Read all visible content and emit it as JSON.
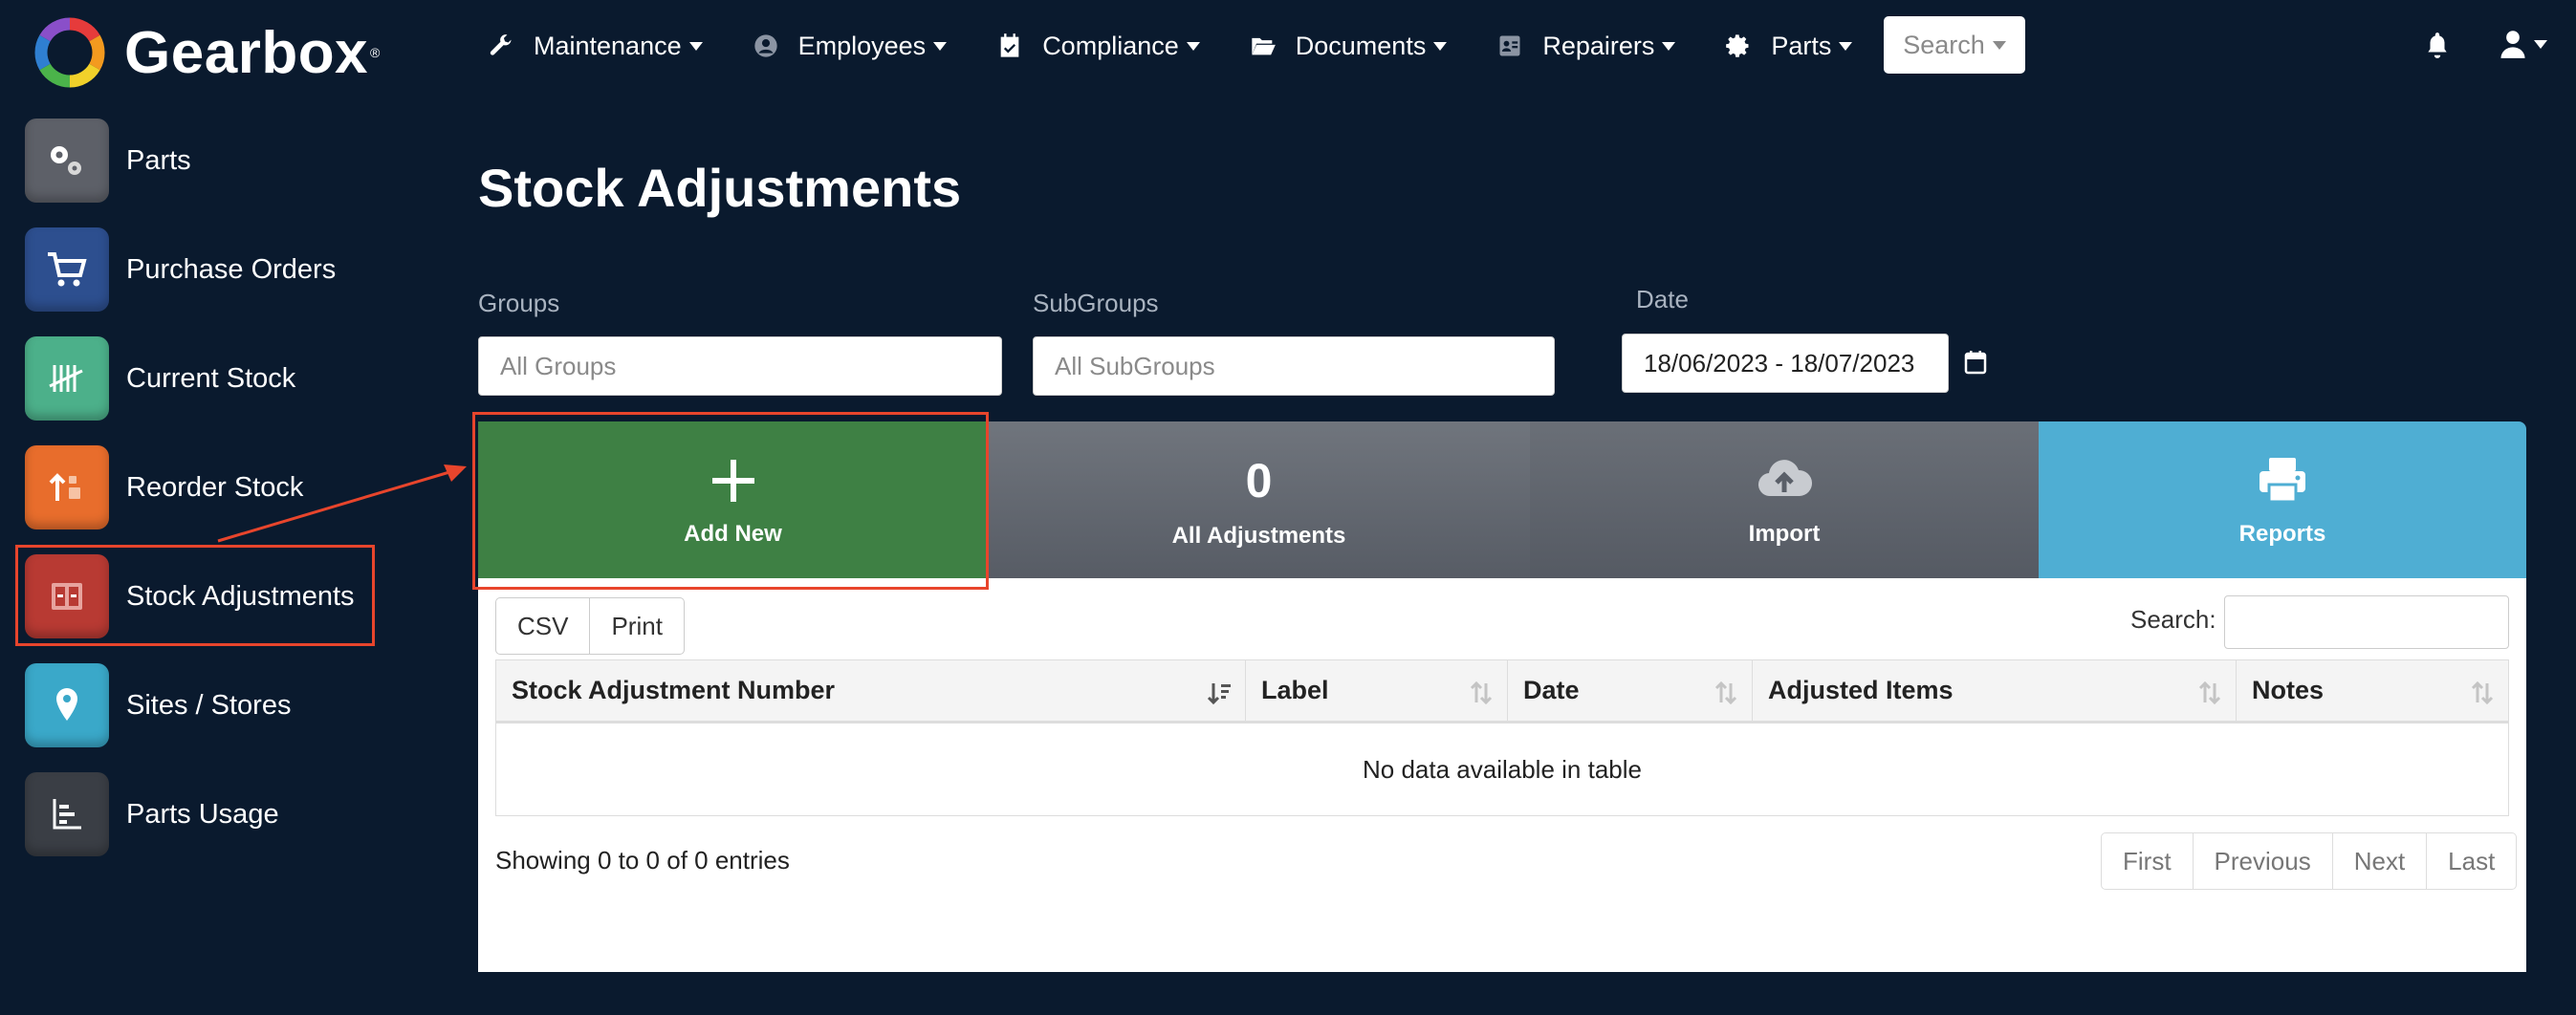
{
  "app": {
    "brand": "Gearbox",
    "reg_mark": "®"
  },
  "nav": {
    "items": [
      {
        "label": "Maintenance",
        "icon": "wrench-icon"
      },
      {
        "label": "Employees",
        "icon": "user-circle-icon"
      },
      {
        "label": "Compliance",
        "icon": "calendar-check-icon"
      },
      {
        "label": "Documents",
        "icon": "folder-open-icon"
      },
      {
        "label": "Repairers",
        "icon": "id-card-icon"
      },
      {
        "label": "Parts",
        "icon": "gear-icon"
      }
    ],
    "search_label": "Search"
  },
  "sidebar": {
    "items": [
      {
        "label": "Parts",
        "color": "#5d6068"
      },
      {
        "label": "Purchase Orders",
        "color": "#2d4f8f"
      },
      {
        "label": "Current Stock",
        "color": "#4cb08a"
      },
      {
        "label": "Reorder Stock",
        "color": "#e86d2c"
      },
      {
        "label": "Stock Adjustments",
        "color": "#b83a33"
      },
      {
        "label": "Sites / Stores",
        "color": "#3aa8c9"
      },
      {
        "label": "Parts Usage",
        "color": "#3a3e45"
      }
    ]
  },
  "page": {
    "title": "Stock Adjustments"
  },
  "filters": {
    "groups_label": "Groups",
    "groups_placeholder": "All Groups",
    "subgroups_label": "SubGroups",
    "subgroups_placeholder": "All SubGroups",
    "date_label": "Date",
    "date_value": "18/06/2023 - 18/07/2023"
  },
  "tiles": {
    "add_label": "Add New",
    "all_count": "0",
    "all_label": "All Adjustments",
    "import_label": "Import",
    "reports_label": "Reports"
  },
  "table": {
    "buttons": [
      "CSV",
      "Print"
    ],
    "search_label": "Search:",
    "columns": [
      "Stock Adjustment Number",
      "Label",
      "Date",
      "Adjusted Items",
      "Notes"
    ],
    "empty_message": "No data available in table",
    "info": "Showing 0 to 0 of 0 entries",
    "pager": [
      "First",
      "Previous",
      "Next",
      "Last"
    ]
  },
  "colors": {
    "background": "#0a1a2e",
    "add_tile": "#3e8044",
    "reports_tile": "#4faed3",
    "highlight": "#e8452c"
  }
}
